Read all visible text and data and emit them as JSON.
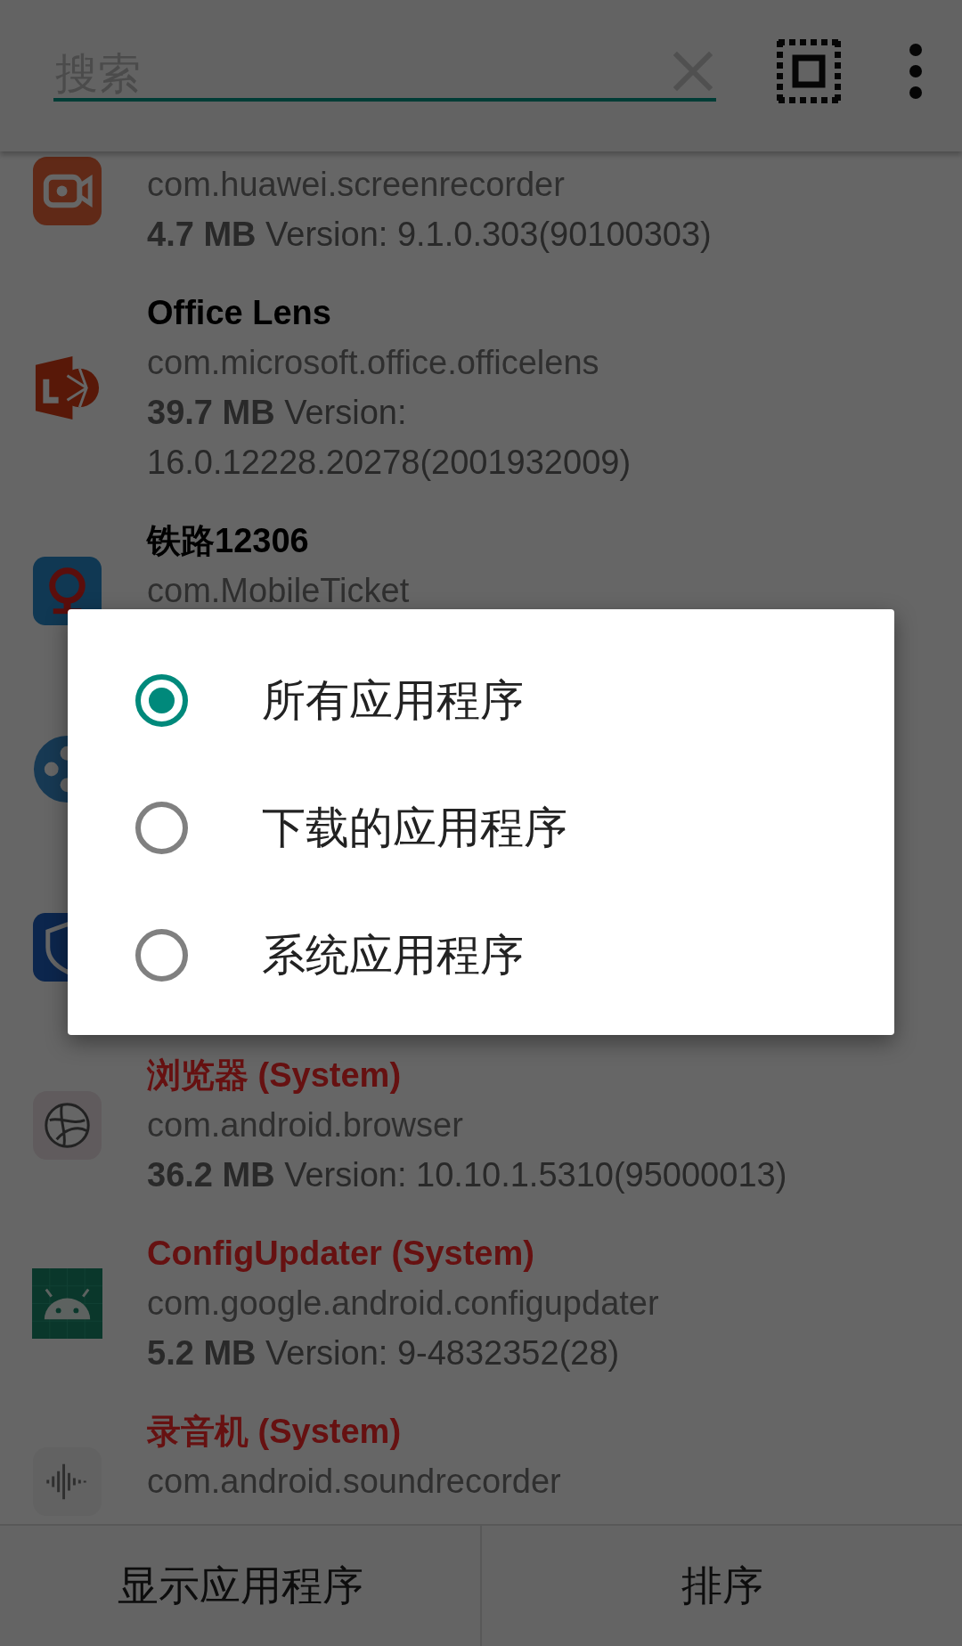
{
  "search": {
    "placeholder": "搜索"
  },
  "apps": [
    {
      "package": "com.huawei.screenrecorder",
      "size": "4.7 MB",
      "version": "Version: 9.1.0.303(90100303)"
    },
    {
      "name": "Office Lens",
      "system": false,
      "package": "com.microsoft.office.officelens",
      "size": "39.7 MB",
      "version": "Version: 16.0.12228.20278(2001932009)"
    },
    {
      "name": "铁路12306",
      "system": false,
      "package": "com.MobileTicket"
    },
    {
      "kind": "covered"
    },
    {
      "kind": "covered"
    },
    {
      "name": "浏览器 (System)",
      "system": true,
      "package": "com.android.browser",
      "size": "36.2 MB",
      "version": "Version: 10.10.1.5310(95000013)"
    },
    {
      "name": "ConfigUpdater (System)",
      "system": true,
      "package": "com.google.android.configupdater",
      "size": "5.2 MB",
      "version": "Version: 9-4832352(28)"
    },
    {
      "name": "录音机 (System)",
      "system": true,
      "package": "com.android.soundrecorder"
    }
  ],
  "dialog": {
    "options": [
      {
        "label": "所有应用程序",
        "selected": true
      },
      {
        "label": "下载的应用程序",
        "selected": false
      },
      {
        "label": "系统应用程序",
        "selected": false
      }
    ]
  },
  "bottom_buttons": [
    "显示应用程序",
    "排序"
  ]
}
